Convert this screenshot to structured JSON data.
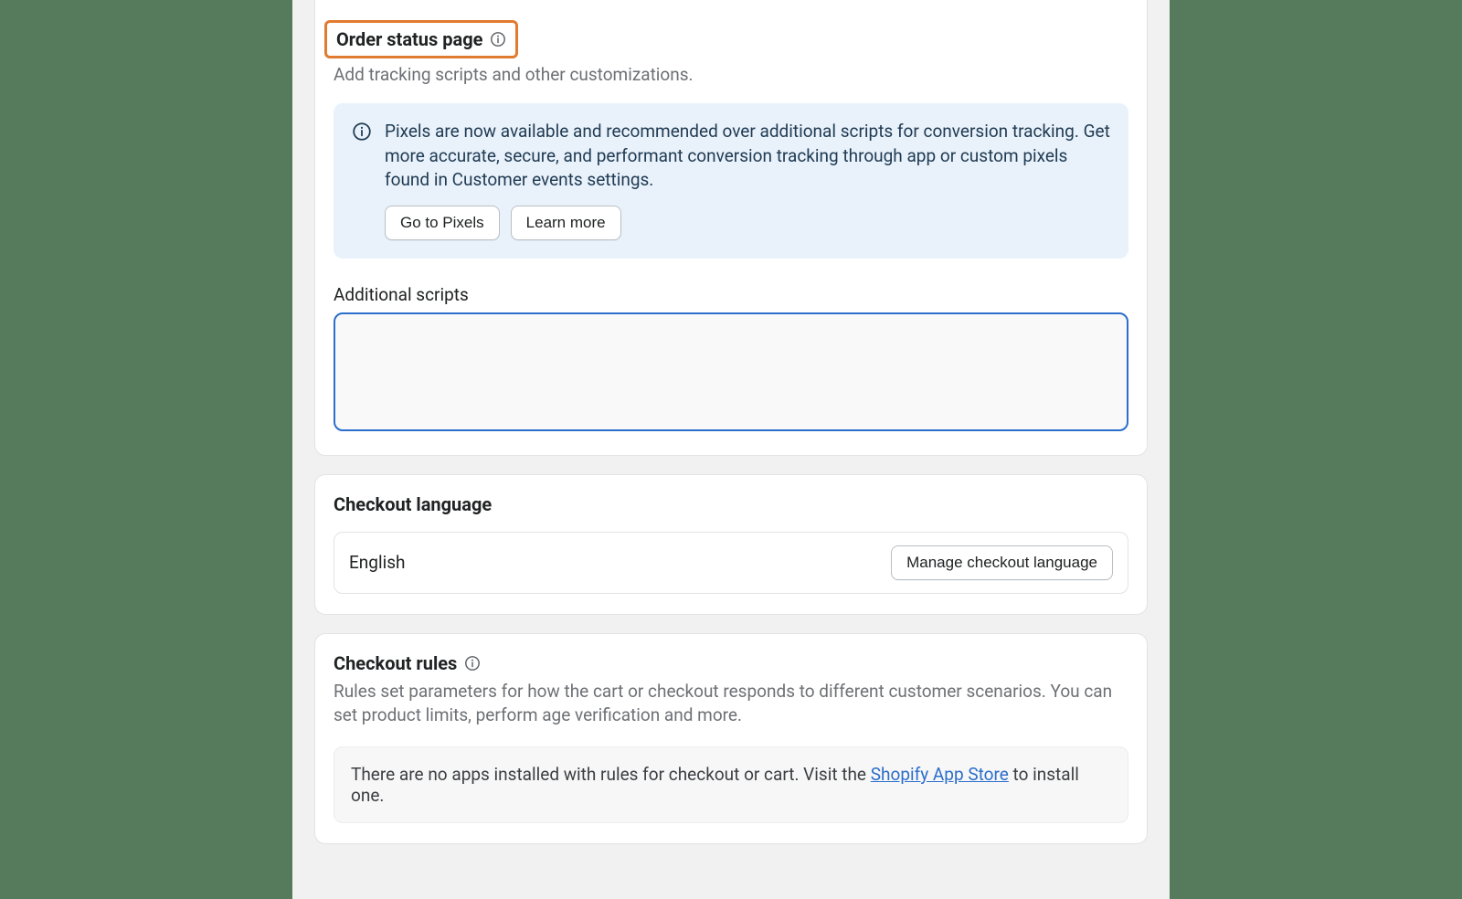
{
  "order_status": {
    "title": "Order status page",
    "subtitle": "Add tracking scripts and other customizations.",
    "banner": {
      "text": "Pixels are now available and recommended over additional scripts for conversion tracking. Get more accurate, secure, and performant conversion tracking through app or custom pixels found in Customer events settings.",
      "go_to_pixels_label": "Go to Pixels",
      "learn_more_label": "Learn more"
    },
    "additional_scripts_label": "Additional scripts",
    "additional_scripts_value": ""
  },
  "checkout_language": {
    "title": "Checkout language",
    "value": "English",
    "manage_label": "Manage checkout language"
  },
  "checkout_rules": {
    "title": "Checkout rules",
    "description": "Rules set parameters for how the cart or checkout responds to different customer scenarios. You can set product limits, perform age verification and more.",
    "empty_prefix": "There are no apps installed with rules for checkout or cart. Visit the ",
    "empty_link": "Shopify App Store",
    "empty_suffix": " to install one."
  }
}
